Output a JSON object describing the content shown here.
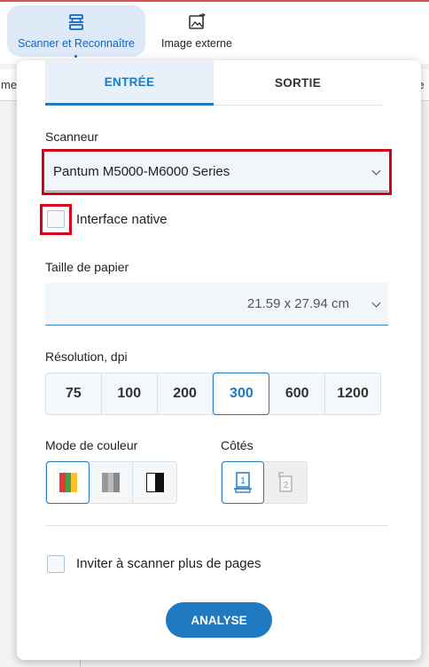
{
  "toolbar": {
    "scan_label": "Scanner et Reconnaître",
    "external_label": "Image externe"
  },
  "background": {
    "left_fragment": "mer",
    "right_fragment": "Re"
  },
  "tabs": {
    "input_label": "ENTRÉE",
    "output_label": "SORTIE"
  },
  "scanner": {
    "label": "Scanneur",
    "value": "Pantum M5000-M6000 Series",
    "native_interface_label": "Interface native",
    "native_interface_checked": false
  },
  "paper": {
    "label": "Taille de papier",
    "value": "21.59 x 27.94 cm"
  },
  "resolution": {
    "label": "Résolution, dpi",
    "options": [
      "75",
      "100",
      "200",
      "300",
      "600",
      "1200"
    ],
    "selected": "300"
  },
  "color_mode": {
    "label": "Mode de couleur",
    "options": [
      "color-mode-icon",
      "grayscale-mode-icon",
      "black-white-mode-icon"
    ],
    "selected": "color-mode-icon"
  },
  "sides": {
    "label": "Côtés",
    "options": [
      "1",
      "2"
    ],
    "selected": "1"
  },
  "more_pages": {
    "label": "Inviter à scanner plus de pages",
    "checked": false
  },
  "action": {
    "analyse_label": "ANALYSE"
  },
  "colors": {
    "accent": "#1f7ac2",
    "highlight_red": "#d0021b",
    "toolbar_active_bg": "#dde9f6"
  }
}
